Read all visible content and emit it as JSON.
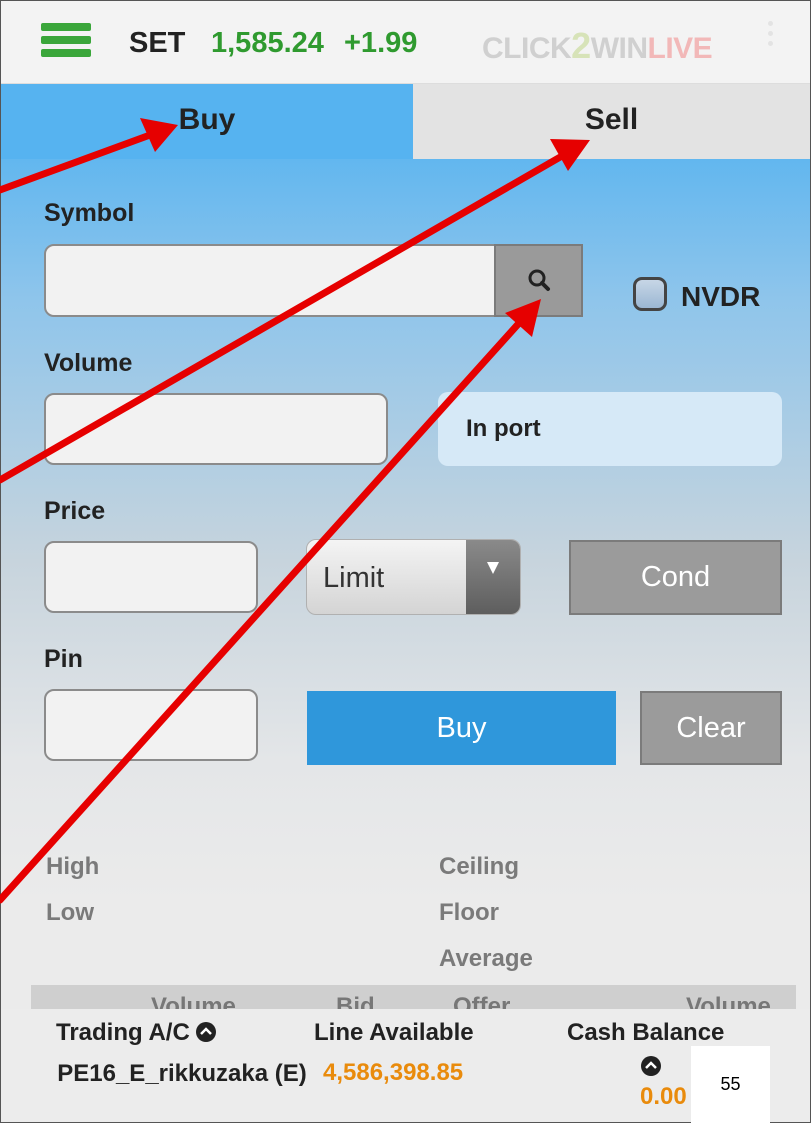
{
  "header": {
    "index_name": "SET",
    "index_value": "1,585.24",
    "index_change": "+1.99",
    "logo_part1": "CLICK",
    "logo_part2": "2",
    "logo_part3": "WIN",
    "logo_part4": "LIVE"
  },
  "tabs": {
    "buy": "Buy",
    "sell": "Sell"
  },
  "form": {
    "symbol_label": "Symbol",
    "symbol_value": "",
    "nvdr_label": "NVDR",
    "volume_label": "Volume",
    "volume_value": "",
    "inport_label": "In port",
    "price_label": "Price",
    "price_value": "",
    "price_type": "Limit",
    "cond_label": "Cond",
    "pin_label": "Pin",
    "pin_value": "",
    "buy_label": "Buy",
    "clear_label": "Clear"
  },
  "stats": {
    "high": "High",
    "low": "Low",
    "ceiling": "Ceiling",
    "floor": "Floor",
    "average": "Average"
  },
  "depth_headers": [
    "Volume",
    "Bid",
    "Offer",
    "Volume"
  ],
  "footer": {
    "trading_label": "Trading A/C",
    "line_label": "Line Available",
    "cash_label": "Cash Balance",
    "account": "PE16_E_rikkuzaka (E)",
    "line_value": "4,586,398.85",
    "cash_value": "0.00"
  },
  "page_number": "55",
  "colors": {
    "accent_green": "#2f9a2f",
    "buy_blue": "#2f97db",
    "orange_value": "#e98b0c",
    "annotation_red": "#e60000"
  }
}
